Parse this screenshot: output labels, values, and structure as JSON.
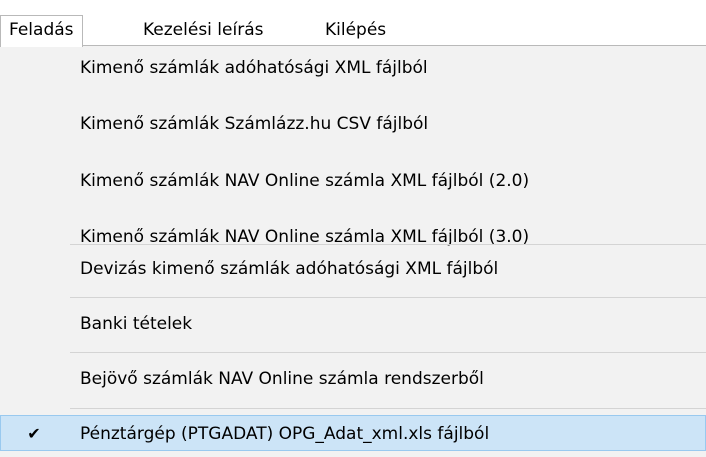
{
  "menubar": {
    "items": [
      {
        "label": "Feladás"
      },
      {
        "label": "Kezelési leírás"
      },
      {
        "label": "Kilépés"
      }
    ]
  },
  "dropdown": {
    "items": [
      {
        "label": "Kimenő számlák adóhatósági XML fájlból"
      },
      {
        "label": "Kimenő számlák Számlázz.hu CSV fájlból"
      },
      {
        "label": "Kimenő számlák NAV Online számla XML fájlból (2.0)"
      },
      {
        "label": "Kimenő számlák NAV Online számla XML fájlból (3.0)"
      },
      {
        "label": "Devizás kimenő számlák adóhatósági XML fájlból"
      },
      {
        "label": "Banki tételek"
      },
      {
        "label": "Bejövő számlák NAV Online számla rendszerből"
      },
      {
        "label": "Pénztárgép (PTGADAT) OPG_Adat_xml.xls fájlból",
        "checked": true,
        "check_glyph": "✔"
      }
    ]
  },
  "colors": {
    "menu_background": "#f2f2f2",
    "highlight_fill": "#cce4f7",
    "highlight_border": "#99c9ef"
  }
}
